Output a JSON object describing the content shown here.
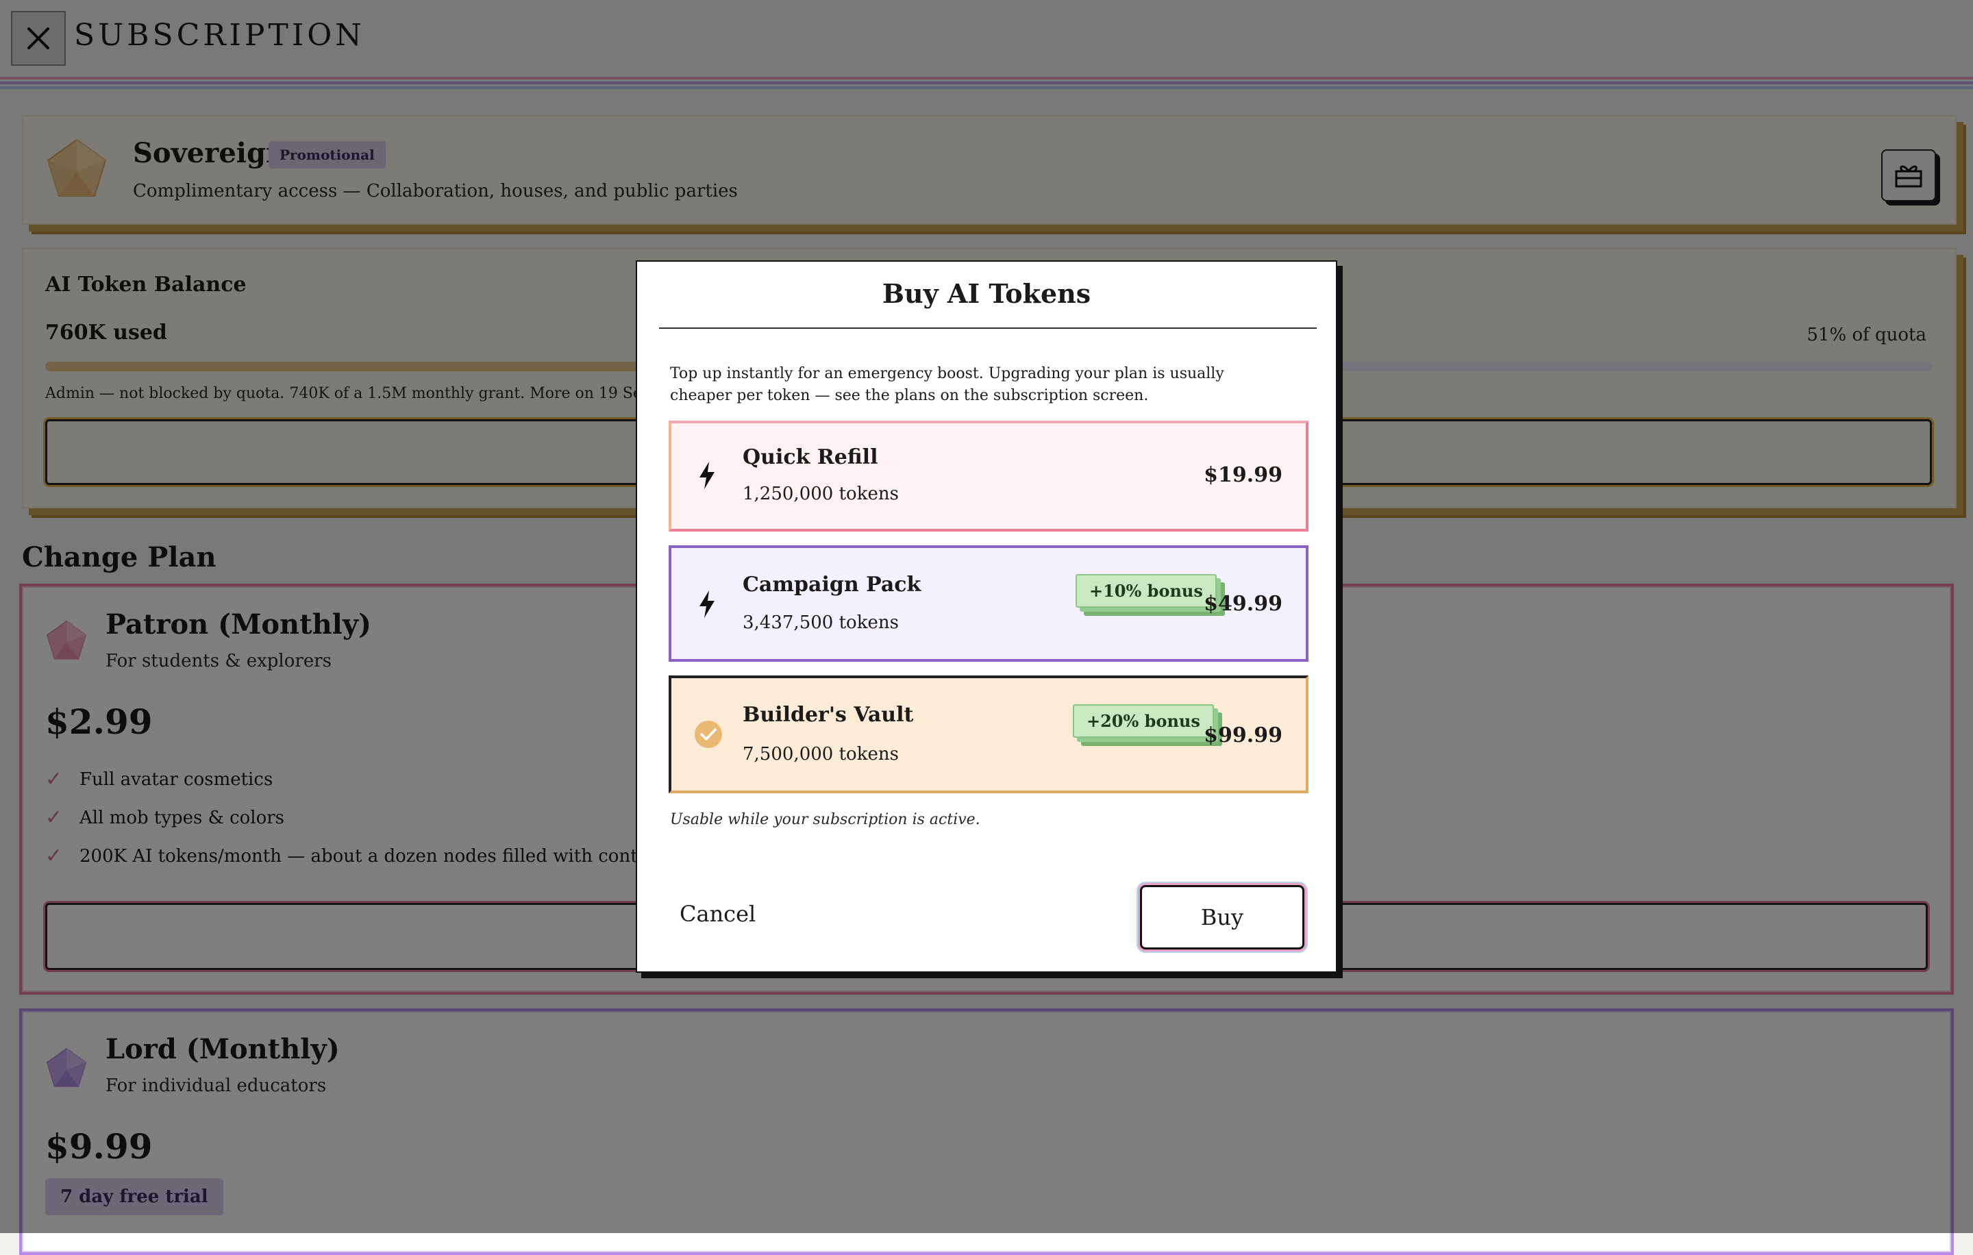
{
  "header": {
    "title": "SUBSCRIPTION",
    "close_icon": "close-icon"
  },
  "current_plan": {
    "name": "Sovereign",
    "badge": "Promotional",
    "description": "Complimentary access — Collaboration, houses, and public parties",
    "gift_icon": "gift-icon"
  },
  "token_balance": {
    "heading": "AI Token Balance",
    "used": "760K used",
    "quota": "51% of quota",
    "usage_fraction": 0.51,
    "note": "Admin — not blocked by quota. 740K of a 1.5M monthly grant. More on 19 Sep."
  },
  "change_plan": {
    "heading": "Change Plan",
    "plans": [
      {
        "name": "Patron (Monthly)",
        "description": "For students & explorers",
        "price": "$2.99",
        "features": [
          "Full avatar cosmetics",
          "All mob types & colors",
          "200K AI tokens/month — about a dozen nodes filled with content"
        ]
      },
      {
        "name": "Lord (Monthly)",
        "description": "For individual educators",
        "price": "$9.99",
        "badge": "7 day free trial"
      }
    ]
  },
  "modal": {
    "title": "Buy AI Tokens",
    "intro": "Top up instantly for an emergency boost. Upgrading your plan is usually cheaper per token — see the plans on the subscription screen.",
    "options": [
      {
        "name": "Quick Refill",
        "tokens": "1,250,000 tokens",
        "price": "$19.99",
        "icon": "lightning-icon",
        "bonus": ""
      },
      {
        "name": "Campaign Pack",
        "tokens": "3,437,500 tokens",
        "price": "$49.99",
        "icon": "lightning-icon",
        "bonus": "+10% bonus"
      },
      {
        "name": "Builder's Vault",
        "tokens": "7,500,000 tokens",
        "price": "$99.99",
        "icon": "check-circle-icon",
        "bonus": "+20% bonus",
        "selected": true
      }
    ],
    "footnote": "Usable while your subscription is active.",
    "cancel_label": "Cancel",
    "buy_label": "Buy"
  },
  "colors": {
    "gold": "#e6b84d",
    "pink": "#e97fa5",
    "purple": "#9a6fd0",
    "green_badge": "#c8e9c2",
    "quick_refill_bg": "#fff2f4",
    "campaign_bg": "#f5f0ff",
    "vault_bg": "#fcecd7"
  }
}
